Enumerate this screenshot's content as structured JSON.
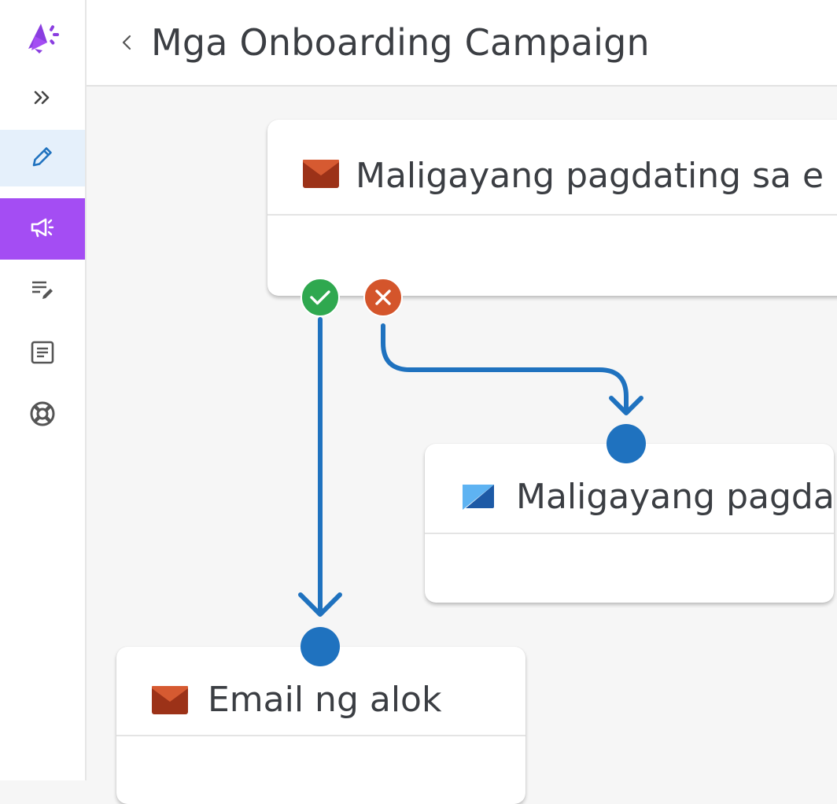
{
  "app": {
    "logo_icon": "megaphone-logo-icon"
  },
  "sidebar": {
    "expand_icon": "double-chevron-right-icon",
    "items": [
      {
        "name": "editor",
        "icon": "pencil-icon",
        "active": false,
        "highlight": true
      },
      {
        "name": "campaigns",
        "icon": "megaphone-icon",
        "active": true
      },
      {
        "name": "drafts",
        "icon": "list-edit-icon",
        "active": false
      },
      {
        "name": "documents",
        "icon": "document-icon",
        "active": false
      },
      {
        "name": "support",
        "icon": "lifebuoy-icon",
        "active": false
      }
    ]
  },
  "header": {
    "back_icon": "chevron-left-icon",
    "title": "Mga Onboarding Campaign"
  },
  "flow": {
    "nodes": [
      {
        "id": "welcome-email",
        "type": "email",
        "icon": "email-icon",
        "title": "Maligayang pagdating sa e"
      },
      {
        "id": "welcome-message",
        "type": "in-app",
        "icon": "in-app-message-icon",
        "title": "Maligayang pagda"
      },
      {
        "id": "offer-email",
        "type": "email",
        "icon": "email-icon",
        "title": "Email ng alok"
      }
    ],
    "branches": [
      {
        "outcome": "success",
        "icon": "check-icon",
        "target": "offer-email"
      },
      {
        "outcome": "failure",
        "icon": "x-icon",
        "target": "welcome-message"
      }
    ]
  },
  "colors": {
    "accent_purple": "#a44df3",
    "editor_highlight": "#e5f0fb",
    "edge_blue": "#1f72bf",
    "success_green": "#2fa84f",
    "failure_orange": "#d4552b",
    "email_red": "#b3391d"
  }
}
